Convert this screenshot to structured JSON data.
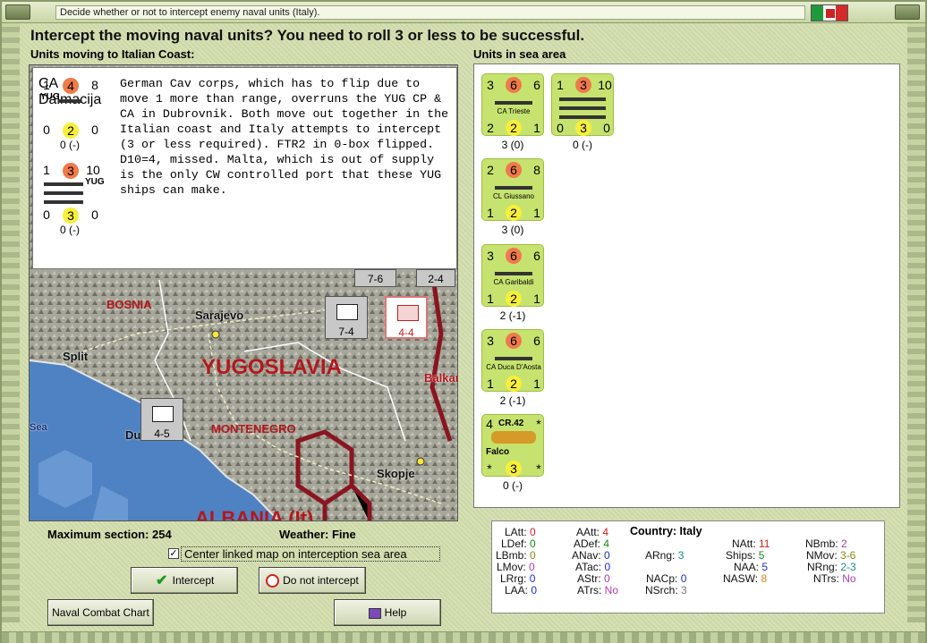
{
  "window": {
    "title": "Decide whether or not to intercept enemy naval units (Italy)."
  },
  "headline": "Intercept the moving naval units?  You need to roll 3 or less to be successful.",
  "left_header": "Units moving to Italian Coast:",
  "right_header": "Units in sea area",
  "moving_units": [
    {
      "top": [
        "1",
        "4",
        "8"
      ],
      "nation": "YUG",
      "name": "CA Dalmacija",
      "bottom": [
        "0",
        "2",
        "0"
      ],
      "caption": "0 (-)"
    },
    {
      "top": [
        "1",
        "3",
        "10"
      ],
      "nation": "YUG",
      "name": "",
      "bottom": [
        "0",
        "3",
        "0"
      ],
      "caption": "0 (-)"
    }
  ],
  "note": "German Cav corps, which has to flip due to move 1 more than range, overruns the YUG CP & CA in Dubrovnik.  Both move out together in the Italian coast and Italy attempts to intercept (3 or less required). FTR2 in 0-box flipped.  D10=4, missed. Malta, which is out of supply is the only CW controlled port that these YUG ships can make.",
  "sea_units": [
    {
      "top": [
        "3",
        "6",
        "6"
      ],
      "name": "CA Trieste",
      "bottom": [
        "2",
        "2",
        "1"
      ],
      "caption": "3 (0)"
    },
    {
      "top": [
        "1",
        "3",
        "10"
      ],
      "name": "",
      "bottom": [
        "0",
        "3",
        "0"
      ],
      "caption": "0 (-)"
    },
    {
      "top": [
        "2",
        "6",
        "8"
      ],
      "name": "CL Giussano",
      "bottom": [
        "1",
        "2",
        "1"
      ],
      "caption": "3 (0)"
    },
    {
      "top": [
        "3",
        "6",
        "6"
      ],
      "name": "CA Garibaldi",
      "bottom": [
        "1",
        "2",
        "1"
      ],
      "caption": "2 (-1)"
    },
    {
      "top": [
        "3",
        "6",
        "6"
      ],
      "name": "CA Duca D'Aosta",
      "bottom": [
        "1",
        "2",
        "1"
      ],
      "caption": "2 (-1)"
    },
    {
      "top": [
        "4",
        "CR.42",
        "*"
      ],
      "name": "Falco",
      "bottom": [
        "*",
        "3",
        "*"
      ],
      "caption": "0 (-)"
    }
  ],
  "map": {
    "labels": [
      "BOSNIA",
      "YUGOSLAVIA",
      "MONTENEGRO",
      "ALBANIA (It)"
    ],
    "cities": [
      "Sarajevo",
      "Split",
      "Dubrovnik",
      "Skopje",
      "Balkan",
      "Sea"
    ],
    "units": [
      {
        "value": "7-6"
      },
      {
        "value": "2-4"
      },
      {
        "value": "7-4"
      },
      {
        "value": "4-4"
      },
      {
        "value": "4-5"
      }
    ]
  },
  "status": {
    "max_section_label": "Maximum section: 254",
    "weather_label": "Weather:  Fine",
    "center_map_label": "Center linked map on interception sea area",
    "center_map_checked": "✓"
  },
  "buttons": {
    "intercept": "Intercept",
    "not_intercept": "Do not intercept",
    "naval_chart": "Naval Combat Chart",
    "help": "Help"
  },
  "stats": {
    "country": "Country: Italy",
    "col1": [
      {
        "k": "LAtt: ",
        "v": "0"
      },
      {
        "k": "LDef: ",
        "v": "0"
      },
      {
        "k": "LBmb: ",
        "v": "0"
      },
      {
        "k": "LMov: ",
        "v": "0"
      },
      {
        "k": "LRrg: ",
        "v": "0"
      },
      {
        "k": "LAA: ",
        "v": "0"
      }
    ],
    "col2": [
      {
        "k": "AAtt: ",
        "v": "4"
      },
      {
        "k": "ADef: ",
        "v": "4"
      },
      {
        "k": "ANav: ",
        "v": "0"
      },
      {
        "k": "ATac: ",
        "v": "0"
      },
      {
        "k": "AStr: ",
        "v": "0"
      },
      {
        "k": "ATrs: ",
        "v": "No"
      }
    ],
    "col3": [
      {
        "k": "ARng: ",
        "v": "3"
      },
      {
        "k": "NACp: ",
        "v": "0"
      },
      {
        "k": "NSrch: ",
        "v": "3"
      }
    ],
    "col4": [
      {
        "k": "NAtt: ",
        "v": "11"
      },
      {
        "k": "Ships: ",
        "v": "5"
      },
      {
        "k": "NAA: ",
        "v": "5"
      },
      {
        "k": "NASW: ",
        "v": "8"
      }
    ],
    "col5": [
      {
        "k": "NBmb: ",
        "v": "2"
      },
      {
        "k": "NMov: ",
        "v": "3-6"
      },
      {
        "k": "NRng: ",
        "v": "2-3"
      },
      {
        "k": "NTrs: ",
        "v": "No"
      }
    ]
  }
}
